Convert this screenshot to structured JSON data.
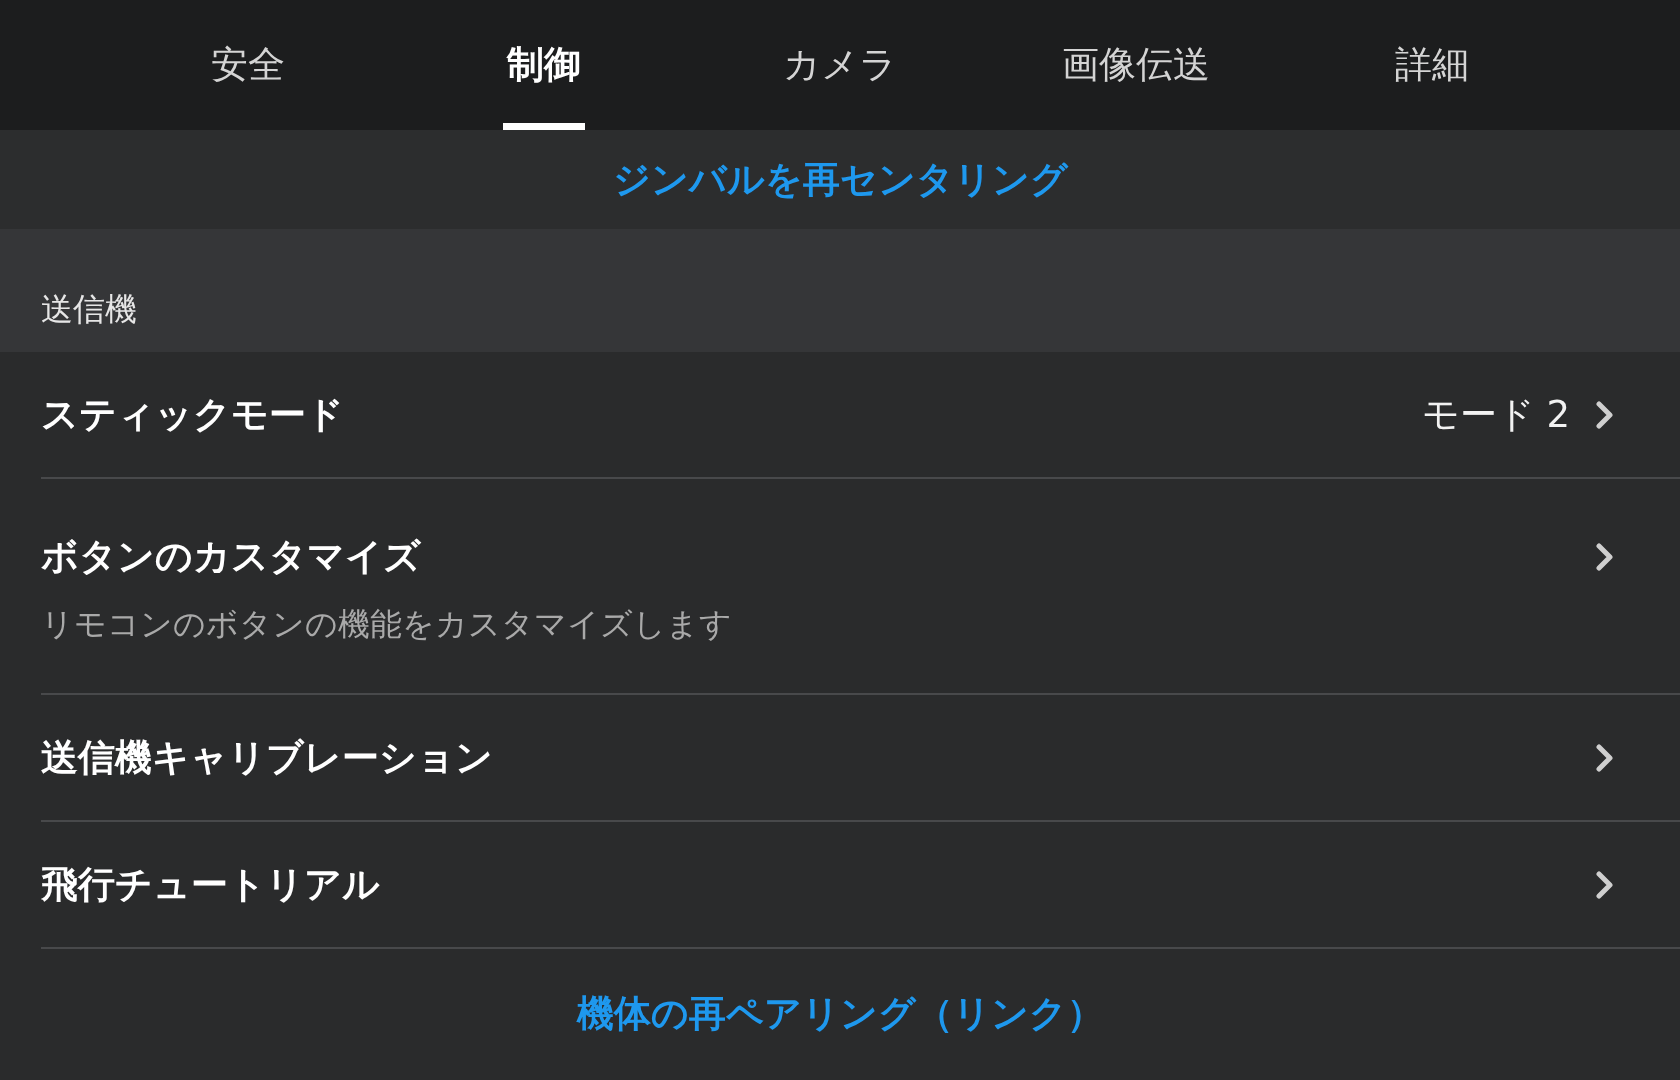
{
  "tabs": [
    {
      "label": "安全",
      "selected": false
    },
    {
      "label": "制御",
      "selected": true
    },
    {
      "label": "カメラ",
      "selected": false
    },
    {
      "label": "画像伝送",
      "selected": false
    },
    {
      "label": "詳細",
      "selected": false
    }
  ],
  "gimbal_link": {
    "label": "ジンバルを再センタリング"
  },
  "section": {
    "title": "送信機",
    "rows": [
      {
        "title": "スティックモード",
        "value": "モード 2"
      },
      {
        "title": "ボタンのカスタマイズ",
        "description": "リモコンのボタンの機能をカスタマイズします"
      },
      {
        "title": "送信機キャリブレーション"
      },
      {
        "title": "飛行チュートリアル"
      }
    ]
  },
  "pair_link": {
    "label": "機体の再ペアリング（リンク）"
  }
}
